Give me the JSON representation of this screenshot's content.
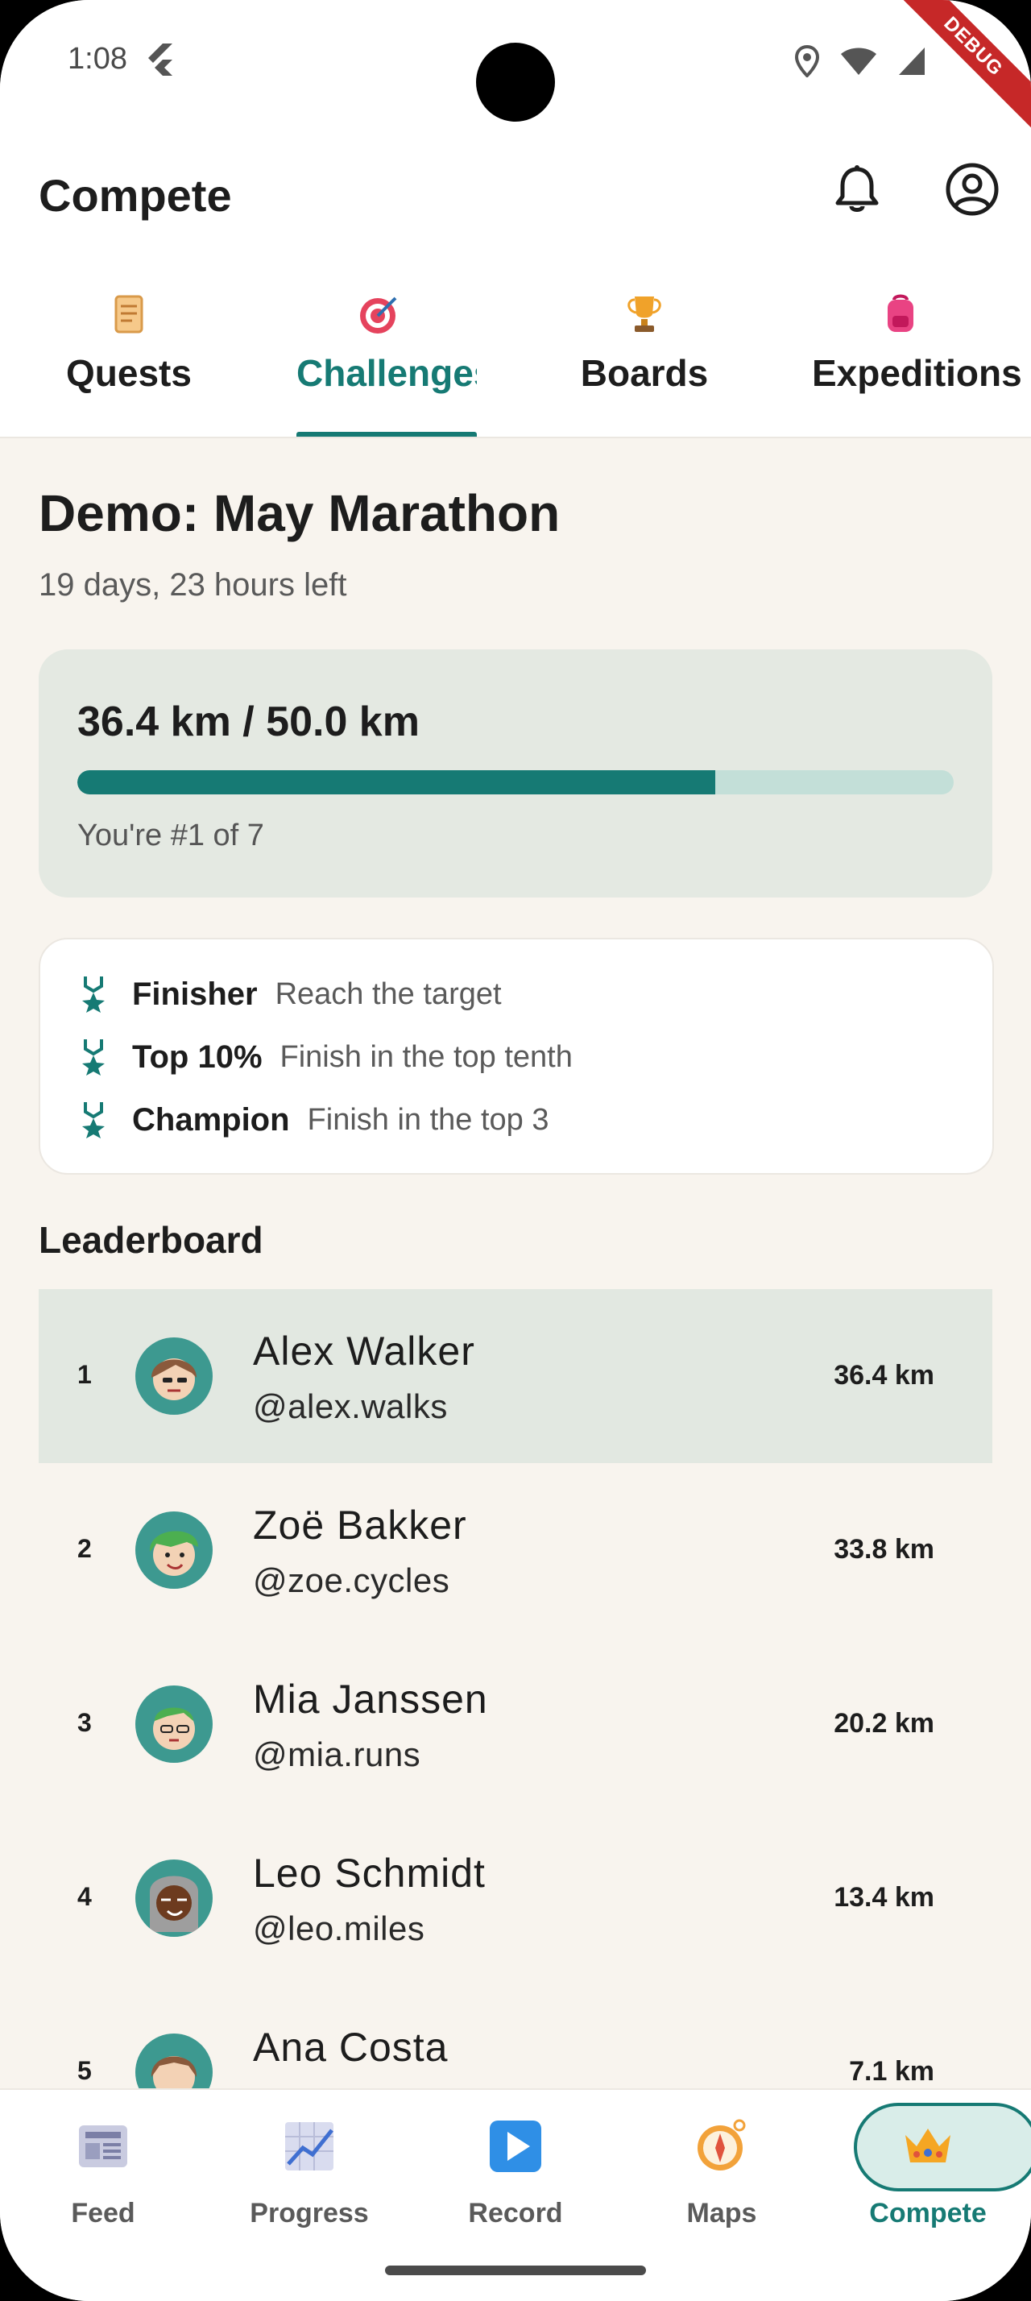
{
  "status_bar": {
    "time": "1:08",
    "debug_label": "DEBUG"
  },
  "app_bar": {
    "title": "Compete"
  },
  "tabs": [
    {
      "label": "Quests",
      "icon": "scroll-icon"
    },
    {
      "label": "Challenges",
      "icon": "target-icon"
    },
    {
      "label": "Boards",
      "icon": "trophy-icon"
    },
    {
      "label": "Expeditions",
      "icon": "backpack-icon"
    }
  ],
  "active_tab": "Challenges",
  "challenge": {
    "title": "Demo: May Marathon",
    "subtitle": "19 days, 23 hours left",
    "progress_text": "36.4 km / 50.0 km",
    "progress_fraction": 0.728,
    "rank_text": "You're #1 of 7"
  },
  "rewards": [
    {
      "name": "Finisher",
      "desc": "Reach the target"
    },
    {
      "name": "Top 10%",
      "desc": "Finish in the top tenth"
    },
    {
      "name": "Champion",
      "desc": "Finish in the top 3"
    }
  ],
  "leaderboard": {
    "title": "Leaderboard",
    "rows": [
      {
        "rank": "1",
        "name": "Alex Walker",
        "handle": "@alex.walks",
        "distance": "36.4 km"
      },
      {
        "rank": "2",
        "name": "Zoë Bakker",
        "handle": "@zoe.cycles",
        "distance": "33.8 km"
      },
      {
        "rank": "3",
        "name": "Mia Janssen",
        "handle": "@mia.runs",
        "distance": "20.2 km"
      },
      {
        "rank": "4",
        "name": "Leo Schmidt",
        "handle": "@leo.miles",
        "distance": "13.4 km"
      },
      {
        "rank": "5",
        "name": "Ana Costa",
        "handle": "",
        "distance": "7.1 km"
      }
    ]
  },
  "bottom_nav": [
    {
      "label": "Feed",
      "icon": "newspaper-icon"
    },
    {
      "label": "Progress",
      "icon": "chart-icon"
    },
    {
      "label": "Record",
      "icon": "play-icon"
    },
    {
      "label": "Maps",
      "icon": "compass-icon"
    },
    {
      "label": "Compete",
      "icon": "crown-icon"
    }
  ],
  "colors": {
    "accent": "#167a74",
    "background": "#f8f4ee",
    "highlight_row": "#e2e8e1",
    "progress_track": "#c3dfd8"
  }
}
